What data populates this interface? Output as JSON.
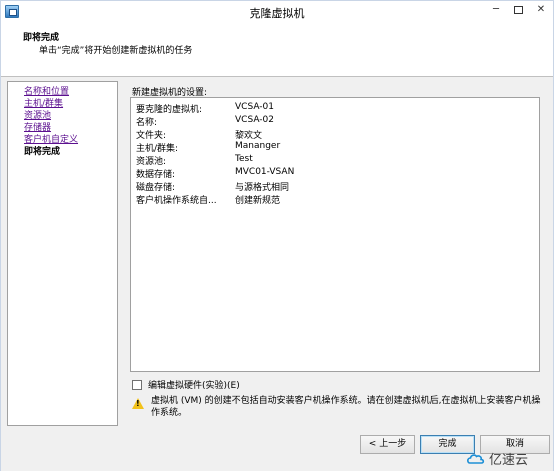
{
  "window": {
    "title": "克隆虚拟机"
  },
  "header": {
    "title": "即将完成",
    "subtitle": "单击“完成”将开始创建新虚拟机的任务"
  },
  "nav": {
    "items": [
      {
        "label": "名称和位置",
        "current": false
      },
      {
        "label": "主机/群集",
        "current": false
      },
      {
        "label": "资源池",
        "current": false
      },
      {
        "label": "存储器",
        "current": false
      },
      {
        "label": "客户机自定义",
        "current": false
      },
      {
        "label": "即将完成",
        "current": true
      }
    ]
  },
  "settings": {
    "label": "新建虚拟机的设置:",
    "rows": [
      {
        "key": "要克隆的虚拟机:",
        "value": "VCSA-01"
      },
      {
        "key": "名称:",
        "value": "VCSA-02"
      },
      {
        "key": "文件夹:",
        "value": "黎欢文"
      },
      {
        "key": "主机/群集:",
        "value": "Mananger"
      },
      {
        "key": "资源池:",
        "value": "Test"
      },
      {
        "key": "数据存储:",
        "value": "MVC01-VSAN"
      },
      {
        "key": "磁盘存储:",
        "value": "与源格式相同"
      },
      {
        "key": "客户机操作系统自...",
        "value": "创建新规范"
      }
    ]
  },
  "options": {
    "edit_hardware_label": "编辑虚拟硬件(实验)(E)",
    "edit_hardware_checked": false
  },
  "warning": {
    "icon": "warning-icon",
    "text": "虚拟机 (VM) 的创建不包括自动安装客户机操作系统。请在创建虚拟机后,在虚拟机上安装客户机操作系统。"
  },
  "footer": {
    "back_label": "< 上一步",
    "finish_label": "完成",
    "cancel_label": "取消"
  },
  "watermark": {
    "text": "亿速云"
  }
}
